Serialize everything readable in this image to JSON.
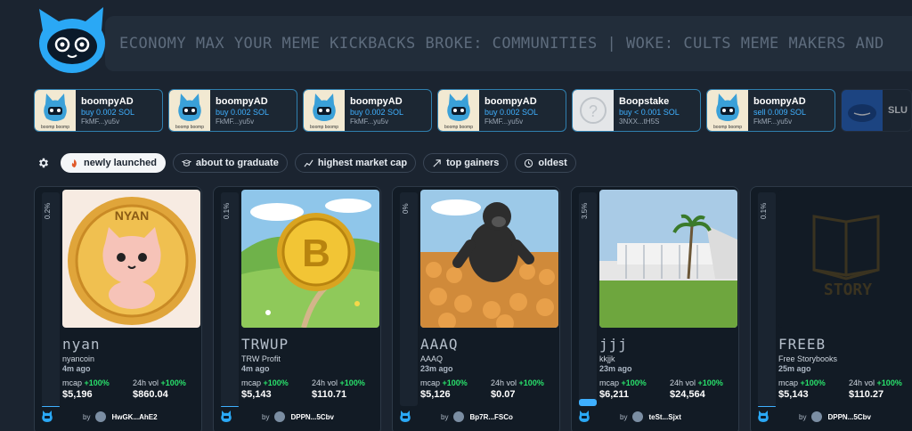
{
  "ticker": {
    "text": "ECONOMY MAX YOUR MEME KICKBACKS BROKE: COMMUNITIES | WOKE: CULTS MEME MAKERS AND"
  },
  "activity": [
    {
      "name": "boompyAD",
      "action": "buy 0.002 SOL",
      "addr": "FkMF...yu5v",
      "thumb": "boomp-cat-icon",
      "thumb_label": "boomp boomp"
    },
    {
      "name": "boompyAD",
      "action": "buy 0.002 SOL",
      "addr": "FkMF...yu5v",
      "thumb": "boomp-cat-icon",
      "thumb_label": "boomp boomp"
    },
    {
      "name": "boompyAD",
      "action": "buy 0.002 SOL",
      "addr": "FkMF...yu5v",
      "thumb": "boomp-cat-icon",
      "thumb_label": "boomp boomp"
    },
    {
      "name": "boompyAD",
      "action": "buy 0.002 SOL",
      "addr": "FkMF...yu5v",
      "thumb": "boomp-cat-icon",
      "thumb_label": "boomp boomp"
    },
    {
      "name": "Boopstake",
      "action": "buy < 0.001 SOL",
      "addr": "3NXX...tH5S",
      "thumb": "question-mark-icon",
      "thumb_label": ""
    },
    {
      "name": "boompyAD",
      "action": "sell 0.009 SOL",
      "addr": "FkMF...yu5v",
      "thumb": "boomp-cat-icon",
      "thumb_label": "boomp boomp"
    },
    {
      "name": "SLU",
      "action": "",
      "addr": "",
      "thumb": "blue-blob-icon",
      "thumb_label": ""
    }
  ],
  "filters": {
    "settings_icon": "gear-icon",
    "items": [
      {
        "label": "newly launched",
        "icon": "fire-icon",
        "active": true
      },
      {
        "label": "about to graduate",
        "icon": "graduation-cap-icon",
        "active": false
      },
      {
        "label": "highest market cap",
        "icon": "chart-line-icon",
        "active": false
      },
      {
        "label": "top gainers",
        "icon": "arrow-up-right-icon",
        "active": false
      },
      {
        "label": "oldest",
        "icon": "clock-icon",
        "active": false
      }
    ]
  },
  "coins": [
    {
      "progress_label": "0.2%",
      "progress": 0.002,
      "ticker": "nyan",
      "name": "nyancoin",
      "age": "4m ago",
      "mcap_label": "mcap",
      "mcap_change": "+100%",
      "mcap": "$5,196",
      "vol_label": "24h vol",
      "vol_change": "+100%",
      "vol": "$860.04",
      "by": "by",
      "creator": "HwGK...AhE2",
      "image": "nyan-cat-coin"
    },
    {
      "progress_label": "0.1%",
      "progress": 0.001,
      "ticker": "TRWUP",
      "name": "TRW Profit",
      "age": "4m ago",
      "mcap_label": "mcap",
      "mcap_change": "+100%",
      "mcap": "$5,143",
      "vol_label": "24h vol",
      "vol_change": "+100%",
      "vol": "$110.71",
      "by": "by",
      "creator": "DPPN...5Cbv",
      "image": "bitcoin-meadow"
    },
    {
      "progress_label": "0%",
      "progress": 0,
      "ticker": "AAAQ",
      "name": "AAAQ",
      "age": "23m ago",
      "mcap_label": "mcap",
      "mcap_change": "+100%",
      "mcap": "$5,126",
      "vol_label": "24h vol",
      "vol_change": "+100%",
      "vol": "$0.07",
      "by": "by",
      "creator": "Bp7R...FSCo",
      "image": "gorilla-dog-army"
    },
    {
      "progress_label": "3.5%",
      "progress": 0.035,
      "ticker": "jjj",
      "name": "kkjjk",
      "age": "23m ago",
      "mcap_label": "mcap",
      "mcap_change": "+100%",
      "mcap": "$6,211",
      "vol_label": "24h vol",
      "vol_change": "+100%",
      "vol": "$24,564",
      "by": "by",
      "creator": "teSt...Sjxt",
      "image": "modern-building"
    },
    {
      "progress_label": "0.1%",
      "progress": 0.001,
      "ticker": "FREEB",
      "name": "Free Storybooks",
      "age": "25m ago",
      "mcap_label": "mcap",
      "mcap_change": "+100%",
      "mcap": "$5,143",
      "vol_label": "24h vol",
      "vol_change": "+100%",
      "vol": "$110.27",
      "by": "by",
      "creator": "DPPN...5Cbv",
      "image": "story-book"
    }
  ]
}
